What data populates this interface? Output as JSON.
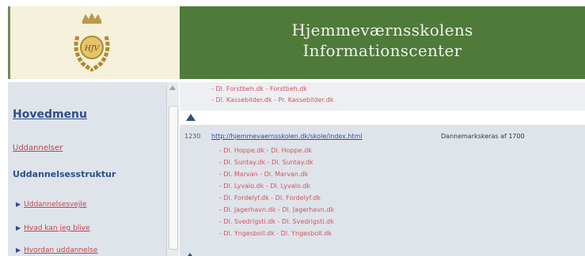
{
  "header": {
    "title_line1": "Hjemmeværnsskolens",
    "title_line2": "Informationscenter",
    "logo_text": "HJV"
  },
  "sidebar": {
    "heading": "Hovedmenu",
    "link": "Uddannelser",
    "section_title": "Uddannelsesstruktur",
    "subitems": [
      "Uddannelsesvejle",
      "Hvad kan jeg blive",
      "Hvordan uddannelse"
    ]
  },
  "content": {
    "prev_lines": [
      "- Dl. Forstbeh.dk - Forstbeh.dk",
      "- Dl. Kassebilder.dk - Pr. Kassebilder.dk"
    ],
    "entry_id": "1230",
    "entry_url": "http://hjemmevaernsskolen.dk/skole/index.html",
    "entry_desc": "Dannemarkskeras af 1700",
    "entry_lines": [
      "- Dl. Hoppe.dk - Dl. Hoppe.dk",
      "- Dl. Suntay.dk - Dl. Suntay.dk",
      "- Dl. Marvan - Dl. Marvan.dk",
      "- Dl. Lyvalo.dk - Dl. Lyvalo.dk",
      "- Dl. Fordelyf.dk - Dl. Fordelyf.dk",
      "- Dl. Jagerhavn.dk - Dl. Jagerhavn.dk",
      "- Dl. Svedrigsti.dk - Dl. Svedrigsti.dk",
      "- Dl. Yngesboll.dk - Dl. Yngesboll.dk"
    ]
  },
  "colors": {
    "banner": "#4f7a3a",
    "logo_bg": "#f5f1dc",
    "panel": "#dfe3ea",
    "link_red": "#c0464a",
    "heading_blue": "#2b4e8e",
    "laurel_gold": "#b08a2e"
  }
}
